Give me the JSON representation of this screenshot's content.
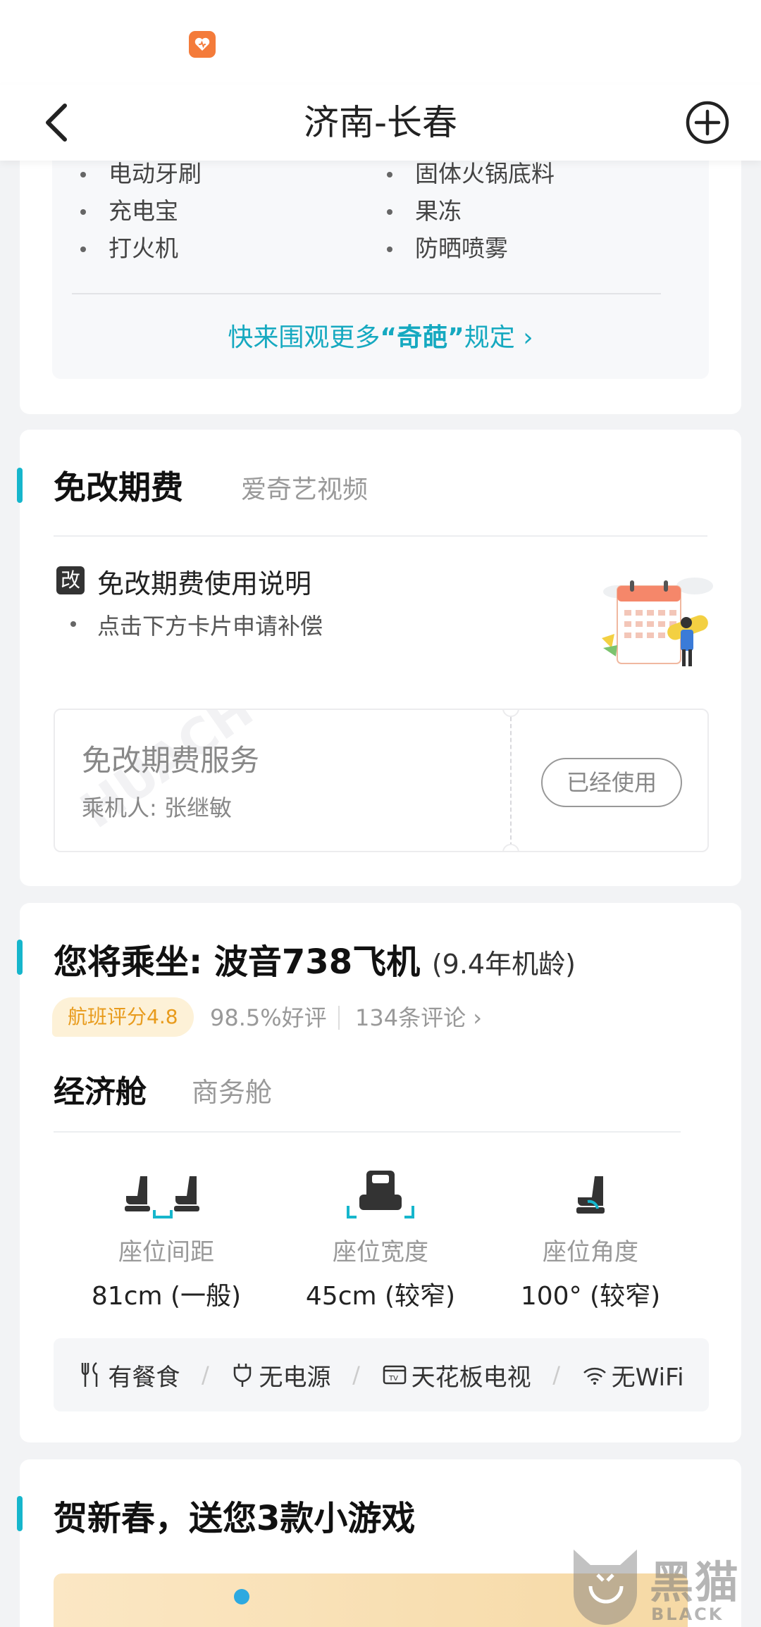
{
  "nav": {
    "title": "济南-长春"
  },
  "prohibited": {
    "left_items": [
      "电动牙刷",
      "充电宝",
      "打火机"
    ],
    "right_items": [
      "固体火锅底料",
      "果冻",
      "防晒喷雾"
    ],
    "more_prefix": "快来围观更多",
    "more_highlight": "“奇葩”",
    "more_suffix": "规定 ›"
  },
  "free_change": {
    "title": "免改期费",
    "sponsor": "爱奇艺视频",
    "badge": "改",
    "info_title": "免改期费使用说明",
    "info_bullet": "点击下方卡片申请补偿",
    "ticket_name": "免改期费服务",
    "passenger": "乘机人: 张继敏",
    "status_button": "已经使用"
  },
  "aircraft": {
    "title": "您将乘坐: 波音738飞机",
    "age": "(9.4年机龄)",
    "rating": "航班评分4.8",
    "good_rate": "98.5%好评",
    "reviews": "134条评论 ›",
    "tab_economy": "经济舱",
    "tab_business": "商务舱",
    "seats": [
      {
        "label": "座位间距",
        "value": "81cm (一般)"
      },
      {
        "label": "座位宽度",
        "value": "45cm (较窄)"
      },
      {
        "label": "座位角度",
        "value": "100° (较窄)"
      }
    ],
    "amenities": [
      "有餐食",
      "无电源",
      "天花板电视",
      "无WiFi"
    ],
    "amenity_separator": "/"
  },
  "games": {
    "title": "贺新春，送您3款小游戏"
  },
  "watermark": {
    "brand": "黑猫",
    "brand_en": "BLACK CAT",
    "ticket_mark": "HUACH"
  },
  "colors": {
    "accent": "#16b6cc",
    "link": "#16a9c0",
    "rating_bg": "#fdf1d7",
    "rating_text": "#e89b1c"
  }
}
